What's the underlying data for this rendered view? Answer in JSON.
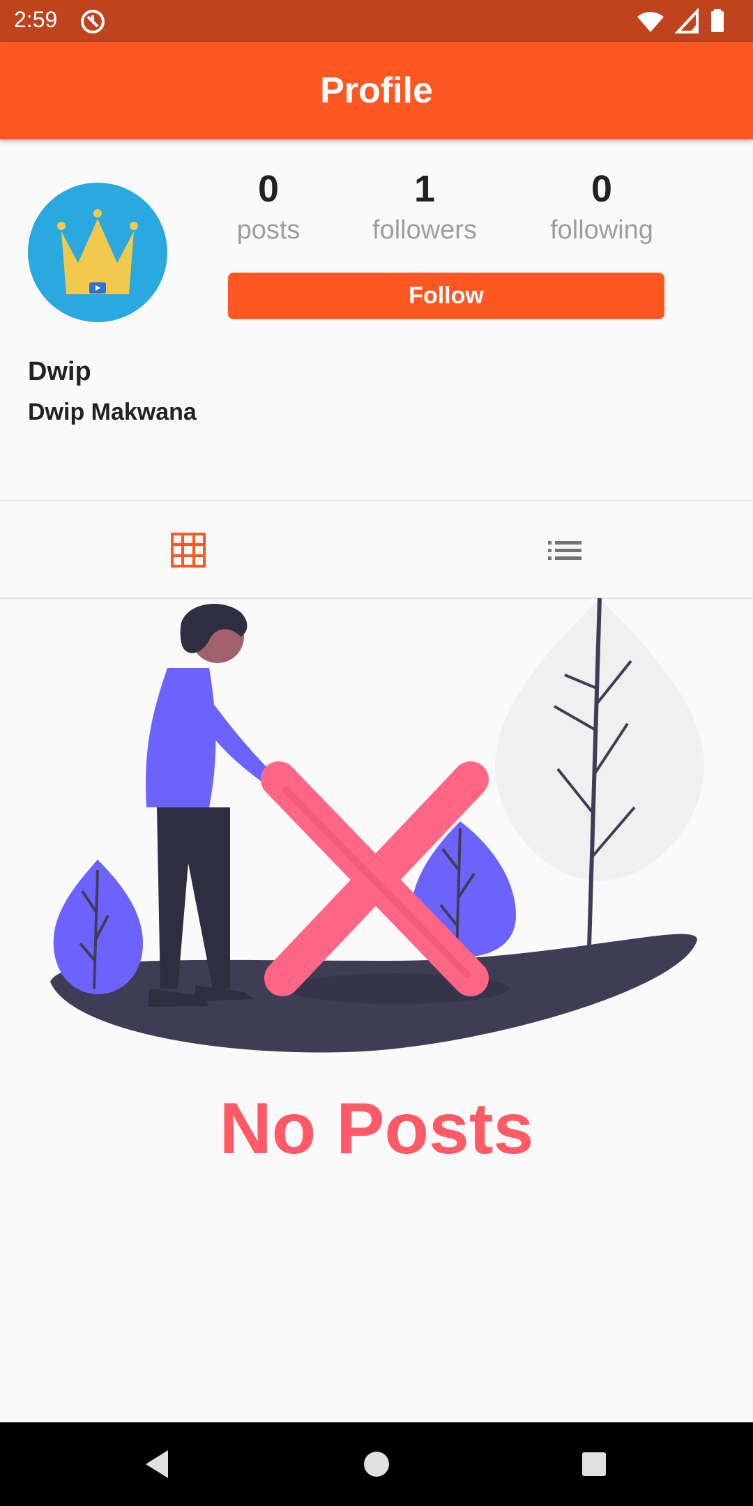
{
  "status_bar": {
    "time": "2:59"
  },
  "app_bar": {
    "title": "Profile"
  },
  "profile": {
    "avatar_text": "Dwip Makwana",
    "stats": [
      {
        "count": "0",
        "label": "posts"
      },
      {
        "count": "1",
        "label": "followers"
      },
      {
        "count": "0",
        "label": "following"
      }
    ],
    "follow_label": "Follow",
    "username": "Dwip",
    "display_name": "Dwip Makwana"
  },
  "tabs": [
    {
      "icon": "grid-icon",
      "active": true
    },
    {
      "icon": "list-icon",
      "active": false
    }
  ],
  "empty_state": {
    "title": "No Posts"
  },
  "colors": {
    "primary": "#ff5722",
    "status_bar": "#bf441d",
    "empty_title": "#ff5a66"
  }
}
